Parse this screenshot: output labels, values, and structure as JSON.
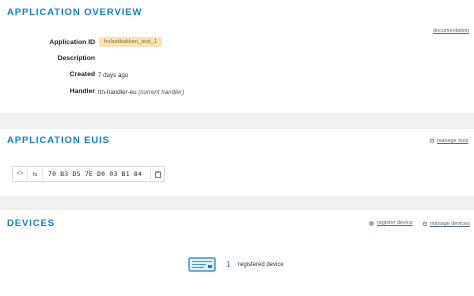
{
  "overview": {
    "title": "APPLICATION OVERVIEW",
    "documentation_link": "documentation",
    "fields": {
      "app_id_label": "Application ID",
      "app_id_value": "holsetbakken_test_1",
      "description_label": "Description",
      "created_label": "Created",
      "created_value": "7 days ago",
      "handler_label": "Handler",
      "handler_value": "ttn-handler-eu",
      "handler_note": "(current handler)"
    }
  },
  "euis": {
    "title": "APPLICATION EUIS",
    "manage_link": "manage euis",
    "eui_value": "70 B3 D5 7E D0 03 B1 84",
    "toggle_icon": "code-icon",
    "swap_icon": "swap-icon",
    "copy_icon": "clipboard-icon"
  },
  "devices": {
    "title": "DEVICES",
    "register_link": "register device",
    "manage_link": "manage devices",
    "count": "1",
    "count_label": "registered device"
  },
  "colors": {
    "accent": "#0d83d0",
    "badge_bg": "#fbe3b0",
    "green_dot": "#7bc67e"
  }
}
